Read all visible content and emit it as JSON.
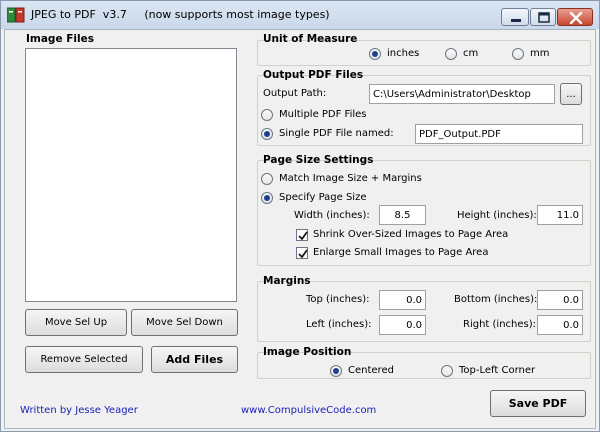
{
  "title": {
    "app_name": "JPEG to PDF  v3.7",
    "tagline": "(now supports most image types)"
  },
  "image_files": {
    "section_title": "Image Files",
    "items": [],
    "move_up_label": "Move Sel Up",
    "move_down_label": "Move Sel Down",
    "remove_label": "Remove Selected",
    "add_label": "Add Files"
  },
  "unit_of_measure": {
    "section_title": "Unit of Measure",
    "options": [
      "inches",
      "cm",
      "mm"
    ],
    "selected": "inches"
  },
  "output_pdf": {
    "section_title": "Output PDF Files",
    "path_label": "Output Path:",
    "path_value": "C:\\Users\\Administrator\\Desktop",
    "browse_label": "...",
    "multiple_label": "Multiple PDF Files",
    "single_label": "Single PDF File named:",
    "single_name_value": "PDF_Output.PDF",
    "selected": "single"
  },
  "page_size": {
    "section_title": "Page Size Settings",
    "match_label": "Match Image Size + Margins",
    "specify_label": "Specify Page Size",
    "selected": "specify",
    "width_label": "Width (inches):",
    "width_value": "8.5",
    "height_label": "Height (inches):",
    "height_value": "11.0",
    "shrink_label": "Shrink Over-Sized Images to Page Area",
    "shrink_checked": true,
    "enlarge_label": "Enlarge Small Images to Page Area",
    "enlarge_checked": true
  },
  "margins": {
    "section_title": "Margins",
    "top_label": "Top (inches):",
    "top_value": "0.0",
    "bottom_label": "Bottom (inches):",
    "bottom_value": "0.0",
    "left_label": "Left (inches):",
    "left_value": "0.0",
    "right_label": "Right (inches):",
    "right_value": "0.0"
  },
  "image_position": {
    "section_title": "Image Position",
    "centered_label": "Centered",
    "top_left_label": "Top-Left Corner",
    "selected": "centered"
  },
  "footer": {
    "author": "Written by Jesse Yeager",
    "website": "www.CompulsiveCode.com",
    "save_label": "Save PDF"
  },
  "icons": {
    "app": "pdf-document-icon",
    "minimize": "minimize-icon",
    "maximize": "maximize-icon",
    "close": "close-icon"
  },
  "colors": {
    "window_bg": "#f0f0f0",
    "link": "#1b23b5",
    "radio_dot": "#1f3f8f",
    "close_button": "#c8472f"
  }
}
